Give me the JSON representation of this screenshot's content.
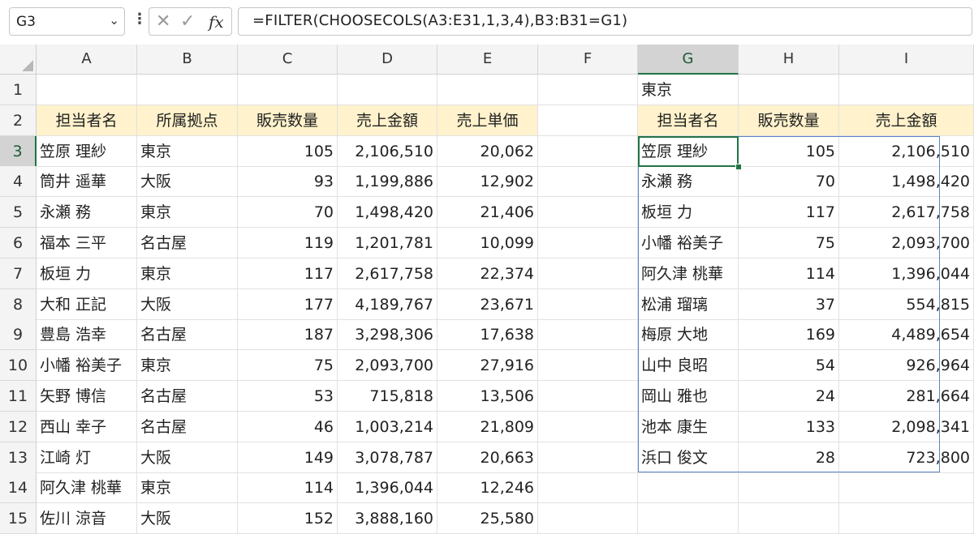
{
  "formula_bar": {
    "name_box": "G3",
    "name_box_icon": "chevron-down-icon",
    "cancel_icon": "✕",
    "enter_icon": "✓",
    "fx_label": "fx",
    "formula": "=FILTER(CHOOSECOLS(A3:E31,1,3,4),B3:B31=G1)"
  },
  "columns": [
    "A",
    "B",
    "C",
    "D",
    "E",
    "F",
    "G",
    "H",
    "I"
  ],
  "selected_column": "G",
  "rows": [
    "1",
    "2",
    "3",
    "4",
    "5",
    "6",
    "7",
    "8",
    "9",
    "10",
    "11",
    "12",
    "13",
    "14",
    "15"
  ],
  "selected_row": "3",
  "colors": {
    "header_fill": "#fff2cc",
    "selection": "#217346",
    "spill_border": "#5b84c4"
  },
  "source_table": {
    "headers": [
      "担当者名",
      "所属拠点",
      "販売数量",
      "売上金額",
      "売上単価"
    ],
    "rows": [
      [
        "笠原 理紗",
        "東京",
        "105",
        "2,106,510",
        "20,062"
      ],
      [
        "筒井 遥華",
        "大阪",
        "93",
        "1,199,886",
        "12,902"
      ],
      [
        "永瀬 務",
        "東京",
        "70",
        "1,498,420",
        "21,406"
      ],
      [
        "福本 三平",
        "名古屋",
        "119",
        "1,201,781",
        "10,099"
      ],
      [
        "板垣 力",
        "東京",
        "117",
        "2,617,758",
        "22,374"
      ],
      [
        "大和 正記",
        "大阪",
        "177",
        "4,189,767",
        "23,671"
      ],
      [
        "豊島 浩幸",
        "名古屋",
        "187",
        "3,298,306",
        "17,638"
      ],
      [
        "小幡 裕美子",
        "東京",
        "75",
        "2,093,700",
        "27,916"
      ],
      [
        "矢野 博信",
        "名古屋",
        "53",
        "715,818",
        "13,506"
      ],
      [
        "西山 幸子",
        "名古屋",
        "46",
        "1,003,214",
        "21,809"
      ],
      [
        "江崎 灯",
        "大阪",
        "149",
        "3,078,787",
        "20,663"
      ],
      [
        "阿久津 桃華",
        "東京",
        "114",
        "1,396,044",
        "12,246"
      ],
      [
        "佐川 涼音",
        "大阪",
        "152",
        "3,888,160",
        "25,580"
      ]
    ]
  },
  "filter_criteria": "東京",
  "result_table": {
    "headers": [
      "担当者名",
      "販売数量",
      "売上金額"
    ],
    "rows": [
      [
        "笠原 理紗",
        "105",
        "2,106,510"
      ],
      [
        "永瀬 務",
        "70",
        "1,498,420"
      ],
      [
        "板垣 力",
        "117",
        "2,617,758"
      ],
      [
        "小幡 裕美子",
        "75",
        "2,093,700"
      ],
      [
        "阿久津 桃華",
        "114",
        "1,396,044"
      ],
      [
        "松浦 瑠璃",
        "37",
        "554,815"
      ],
      [
        "梅原 大地",
        "169",
        "4,489,654"
      ],
      [
        "山中 良昭",
        "54",
        "926,964"
      ],
      [
        "岡山 雅也",
        "24",
        "281,664"
      ],
      [
        "池本 康生",
        "133",
        "2,098,341"
      ],
      [
        "浜口 俊文",
        "28",
        "723,800"
      ]
    ]
  }
}
